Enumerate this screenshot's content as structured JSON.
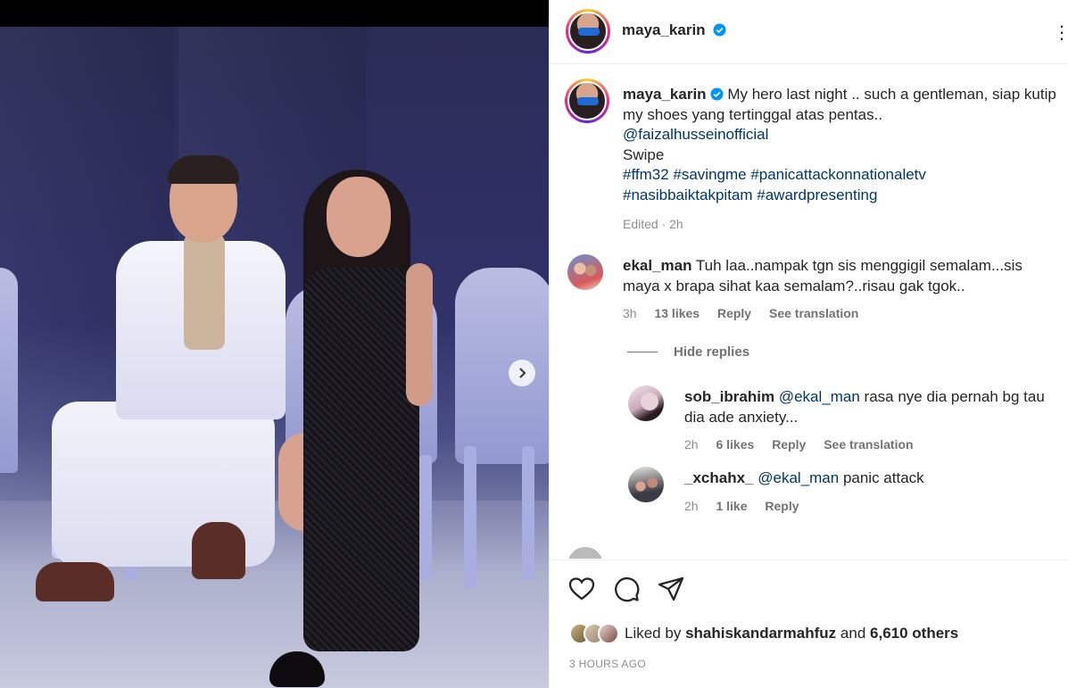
{
  "post": {
    "author": "maya_karin",
    "caption": {
      "author": "maya_karin",
      "line1": "My hero last night .. such a gentleman, siap kutip",
      "line2": "my shoes yang tertinggal atas pentas..",
      "mention": "@faizalhusseinofficial",
      "line4": "Swipe",
      "hashtags_line1": "#ffm32 #savingme #panicattackonnationaletv",
      "hashtags_line2": "#nasibbaiktakpitam #awardpresenting",
      "edited": "Edited · 2h"
    },
    "comments": [
      {
        "user": "ekal_man",
        "text_line1": "Tuh laa..nampak tgn sis menggigil semalam...sis",
        "text_line2": "maya x brapa sihat kaa semalam?..risau gak tgok..",
        "time": "3h",
        "likes": "13 likes",
        "reply": "Reply",
        "translate": "See translation",
        "hide_replies": "Hide replies",
        "replies": [
          {
            "user": "sob_ibrahim",
            "mention": "@ekal_man",
            "text_line1": "rasa nye dia pernah bg tau",
            "text_line2": "dia ade anxiety...",
            "time": "2h",
            "likes": "6 likes",
            "reply": "Reply",
            "translate": "See translation"
          },
          {
            "user": "_xchahx_",
            "mention": "@ekal_man",
            "text": "panic attack",
            "time": "2h",
            "likes": "1 like",
            "reply": "Reply"
          }
        ]
      }
    ],
    "likes": {
      "prefix": "Liked by",
      "user": "shahiskandarmahfuz",
      "joiner": "and",
      "others": "6,610 others"
    },
    "timestamp": "3 HOURS AGO",
    "icons": {
      "like": "heart-icon",
      "comment": "comment-icon",
      "share": "share-icon",
      "verified": "verified-badge-icon",
      "next": "chevron-right-icon",
      "more": "more-options-icon"
    },
    "colors": {
      "link": "#00376b",
      "verified": "#0095f6",
      "muted": "#8e8e8e"
    }
  }
}
